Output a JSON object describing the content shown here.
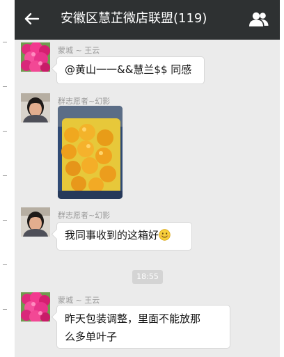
{
  "header": {
    "title": "安徽区慧芷微店联盟(119)"
  },
  "messages": [
    {
      "sender": "蒙城 ~ 王云",
      "text": "@黄山一一&&慧兰$$ 同感"
    },
    {
      "sender": "群志愿者~幻影",
      "type": "image"
    },
    {
      "sender": "群志愿者~幻影",
      "text": "我同事收到的这箱好",
      "emoji": "smiling-face-emoji"
    },
    {
      "sender": "蒙城 ~ 王云",
      "text_line1": "昨天包装调整，里面不能放那",
      "text_line2": "么多单叶子"
    }
  ],
  "timestamp": "18:55",
  "colors": {
    "header_bg": "#2e3132",
    "chat_bg": "#ebebeb",
    "bubble_bg": "#ffffff",
    "sender_text": "#9a9a9a"
  }
}
